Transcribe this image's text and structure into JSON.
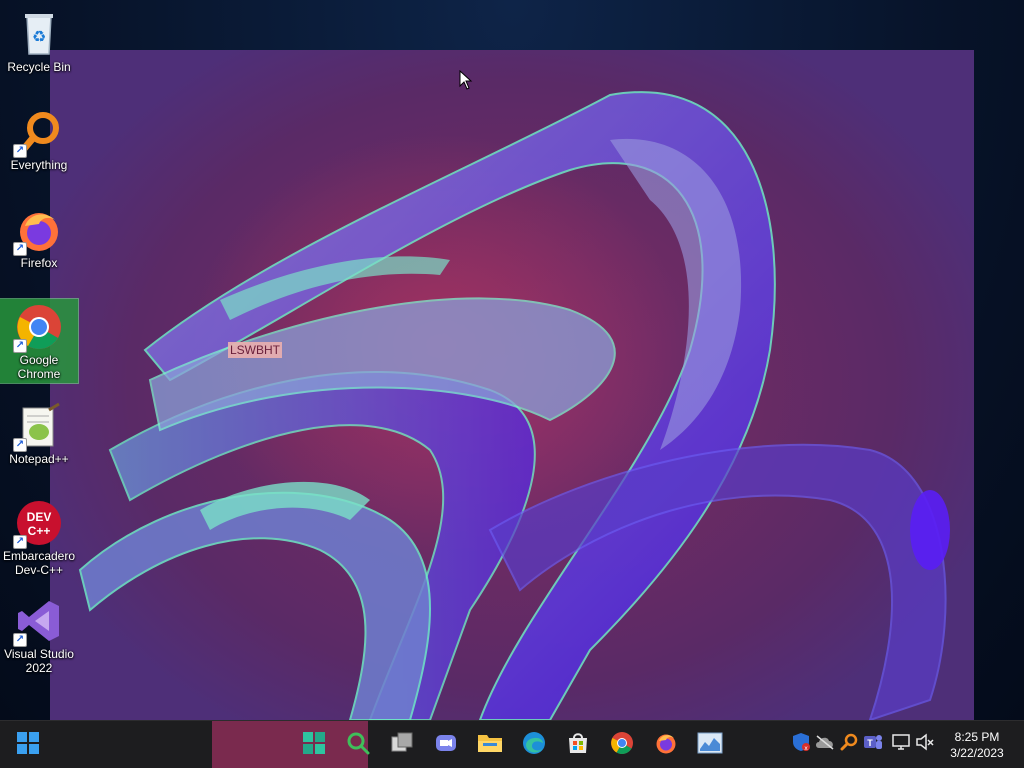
{
  "desktop": {
    "icons": [
      {
        "label": "Recycle Bin",
        "icon": "recycle-bin-icon"
      },
      {
        "label": "Everything",
        "icon": "everything-search-icon"
      },
      {
        "label": "Firefox",
        "icon": "firefox-icon"
      },
      {
        "label": "Google Chrome",
        "icon": "chrome-icon"
      },
      {
        "label": "Notepad++",
        "icon": "notepad-plus-plus-icon"
      },
      {
        "label": "Embarcadero Dev-C++",
        "icon": "dev-cpp-icon"
      },
      {
        "label": "Visual Studio 2022",
        "icon": "visual-studio-icon"
      }
    ],
    "selected_icon": "Google Chrome",
    "wallpaper_label": "LSWBHT"
  },
  "taskbar": {
    "apps": [
      "start-icon",
      "widgets-icon",
      "search-icon",
      "task-view-icon",
      "chat-icon",
      "file-explorer-icon",
      "edge-icon",
      "store-icon",
      "chrome-icon",
      "firefox-icon",
      "resource-monitor-icon"
    ],
    "tray": [
      "security-icon",
      "onedrive-icon",
      "everything-tray-icon",
      "teams-icon",
      "network-icon",
      "volume-muted-icon"
    ],
    "clock": {
      "time": "8:25 PM",
      "date": "3/22/2023"
    }
  },
  "colors": {
    "taskbar_bg": "#1d1d1f",
    "selection": "#2a963c",
    "wallpaper_base": "#6a2b64"
  }
}
